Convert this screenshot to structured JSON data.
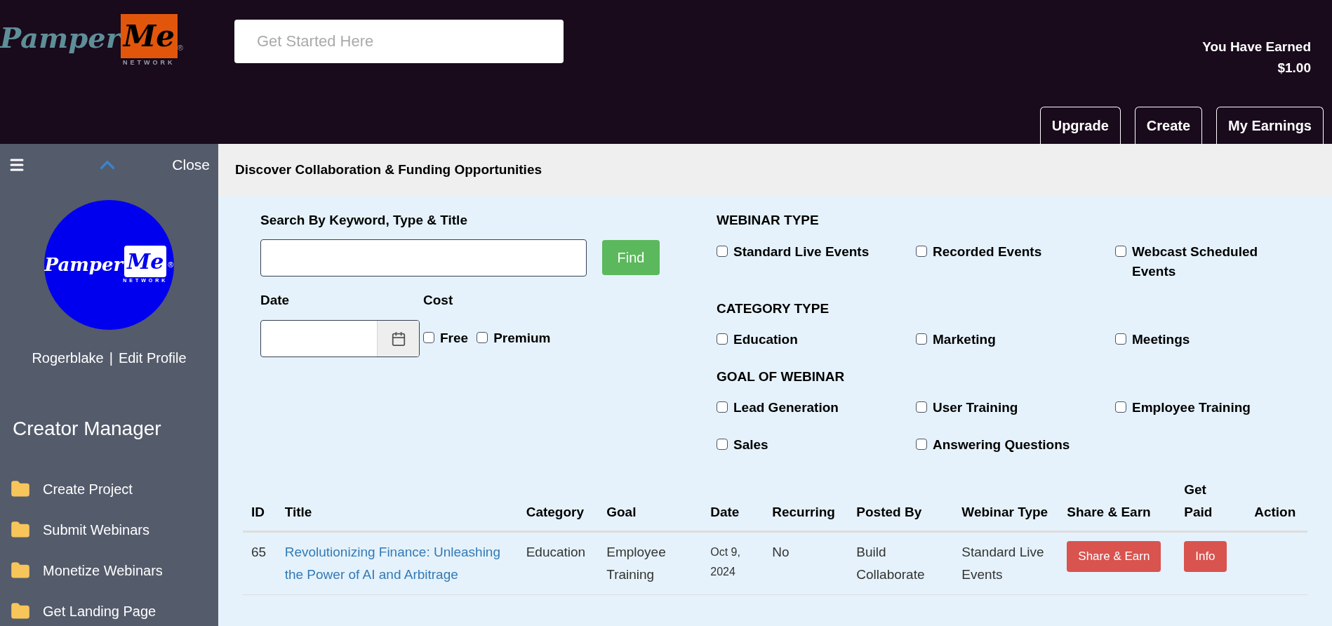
{
  "header": {
    "logo": {
      "word": "Pamper",
      "mark": "Me",
      "sub": "NETWORK",
      "reg": "®"
    },
    "search": {
      "placeholder": "Get Started Here"
    },
    "earned_label": "You Have Earned",
    "earned_value": "$1.00",
    "buttons": [
      "Upgrade",
      "Create",
      "My Earnings"
    ]
  },
  "sidebar": {
    "close": "Close",
    "avatar_logo": {
      "word": "Pamper",
      "mark": "Me",
      "sub": "NETWORK",
      "reg": "®"
    },
    "username": "Rogerblake",
    "separator": "|",
    "edit_profile": "Edit Profile",
    "section_title": "Creator Manager",
    "items": [
      {
        "label": "Create Project"
      },
      {
        "label": "Submit Webinars"
      },
      {
        "label": "Monetize Webinars"
      },
      {
        "label": "Get Landing Page"
      }
    ]
  },
  "page_title": "Discover Collaboration & Funding Opportunities",
  "filters": {
    "keyword_label": "Search By Keyword, Type & Title",
    "find_button": "Find",
    "date_label": "Date",
    "cost_label": "Cost",
    "cost_options": [
      {
        "label": "Free",
        "checked": false
      },
      {
        "label": "Premium",
        "checked": false
      }
    ],
    "groups": [
      {
        "title": "WEBINAR TYPE",
        "options": [
          {
            "label": "Standard Live Events",
            "checked": false
          },
          {
            "label": "Recorded Events",
            "checked": false
          },
          {
            "label": "Webcast Scheduled Events",
            "checked": false
          }
        ]
      },
      {
        "title": "CATEGORY TYPE",
        "options": [
          {
            "label": "Education",
            "checked": false
          },
          {
            "label": "Marketing",
            "checked": false
          },
          {
            "label": "Meetings",
            "checked": false
          }
        ]
      },
      {
        "title": "GOAL OF WEBINAR",
        "options": [
          {
            "label": "Lead Generation",
            "checked": false
          },
          {
            "label": "User Training",
            "checked": false
          },
          {
            "label": "Employee Training",
            "checked": false
          },
          {
            "label": "Sales",
            "checked": false
          },
          {
            "label": "Answering Questions",
            "checked": false
          }
        ]
      }
    ]
  },
  "table": {
    "columns": [
      "ID",
      "Title",
      "Category",
      "Goal",
      "Date",
      "Recurring",
      "Posted By",
      "Webinar Type",
      "Share & Earn",
      "Get Paid",
      "Action"
    ],
    "rows": [
      {
        "id": "65",
        "title": "Revolutionizing Finance: Unleashing the Power of AI and Arbitrage",
        "category": "Education",
        "goal": "Employee Training",
        "date": "Oct 9, 2024",
        "recurring": "No",
        "posted_by": "Build Collaborate",
        "webinar_type": "Standard Live Events",
        "share_button": "Share & Earn",
        "paid_button": "Info"
      }
    ]
  }
}
